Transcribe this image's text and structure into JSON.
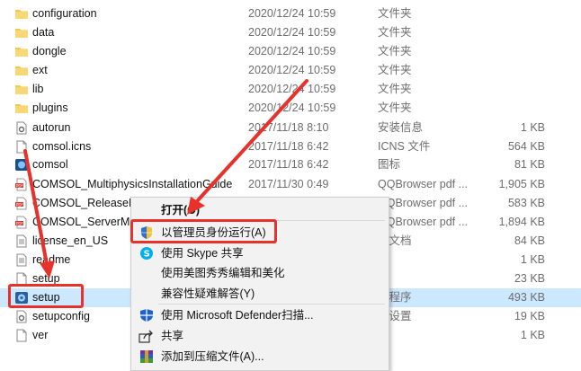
{
  "files": [
    {
      "icon": "folder-icon",
      "name": "configuration",
      "date": "2020/12/24 10:59",
      "type": "文件夹",
      "size": ""
    },
    {
      "icon": "folder-icon",
      "name": "data",
      "date": "2020/12/24 10:59",
      "type": "文件夹",
      "size": ""
    },
    {
      "icon": "folder-icon",
      "name": "dongle",
      "date": "2020/12/24 10:59",
      "type": "文件夹",
      "size": ""
    },
    {
      "icon": "folder-icon",
      "name": "ext",
      "date": "2020/12/24 10:59",
      "type": "文件夹",
      "size": ""
    },
    {
      "icon": "folder-icon",
      "name": "lib",
      "date": "2020/12/24 10:59",
      "type": "文件夹",
      "size": ""
    },
    {
      "icon": "folder-icon",
      "name": "plugins",
      "date": "2020/12/24 10:59",
      "type": "文件夹",
      "size": ""
    },
    {
      "icon": "settings-file-icon",
      "name": "autorun",
      "date": "2017/11/18 8:10",
      "type": "安装信息",
      "size": "1 KB"
    },
    {
      "icon": "file-icon",
      "name": "comsol.icns",
      "date": "2017/11/18 6:42",
      "type": "ICNS 文件",
      "size": "564 KB"
    },
    {
      "icon": "comsol-app-icon",
      "name": "comsol",
      "date": "2017/11/18 6:42",
      "type": "图标",
      "size": "81 KB"
    },
    {
      "icon": "pdf-icon",
      "name": "COMSOL_MultiphysicsInstallationGuide",
      "date": "2017/11/30 0:49",
      "type": "QQBrowser pdf ...",
      "size": "1,905 KB"
    },
    {
      "icon": "pdf-icon",
      "name": "COMSOL_ReleaseNotes",
      "date": "",
      "type": "QQBrowser pdf ...",
      "size": "583 KB"
    },
    {
      "icon": "pdf-icon",
      "name": "COMSOL_ServerManual",
      "date": "",
      "type": "QQBrowser pdf ...",
      "size": "1,894 KB"
    },
    {
      "icon": "text-file-icon",
      "name": "license_en_US",
      "date": "",
      "type": "本文档",
      "size": "84 KB"
    },
    {
      "icon": "text-file-icon",
      "name": "readme",
      "date": "",
      "type": "件",
      "size": "1 KB"
    },
    {
      "icon": "file-icon",
      "name": "setup",
      "date": "",
      "type": "件",
      "size": "23 KB"
    },
    {
      "icon": "setup-app-icon",
      "name": "setup",
      "date": "",
      "type": "用程序",
      "size": "493 KB"
    },
    {
      "icon": "settings-file-icon",
      "name": "setupconfig",
      "date": "",
      "type": "置设置",
      "size": "19 KB"
    },
    {
      "icon": "file-icon",
      "name": "ver",
      "date": "",
      "type": "件",
      "size": "1 KB"
    }
  ],
  "selected_row": 15,
  "context_menu": {
    "items": [
      {
        "label": "打开(O)",
        "icon": "",
        "bold": true
      },
      {
        "label": "以管理员身份运行(A)",
        "icon": "uac-shield-icon",
        "bold": false
      },
      {
        "label": "使用 Skype 共享",
        "icon": "skype-icon",
        "bold": false
      },
      {
        "label": "使用美图秀秀编辑和美化",
        "icon": "",
        "bold": false
      },
      {
        "label": "兼容性疑难解答(Y)",
        "icon": "",
        "bold": false
      },
      {
        "label": "使用 Microsoft Defender扫描...",
        "icon": "defender-shield-icon",
        "bold": false
      },
      {
        "label": "共享",
        "icon": "share-icon",
        "bold": false
      },
      {
        "label": "添加到压缩文件(A)...",
        "icon": "winrar-icon",
        "bold": false
      }
    ]
  },
  "colors": {
    "highlight": "#e8312b",
    "selection": "#cce8ff",
    "folder": "#f7c846"
  }
}
